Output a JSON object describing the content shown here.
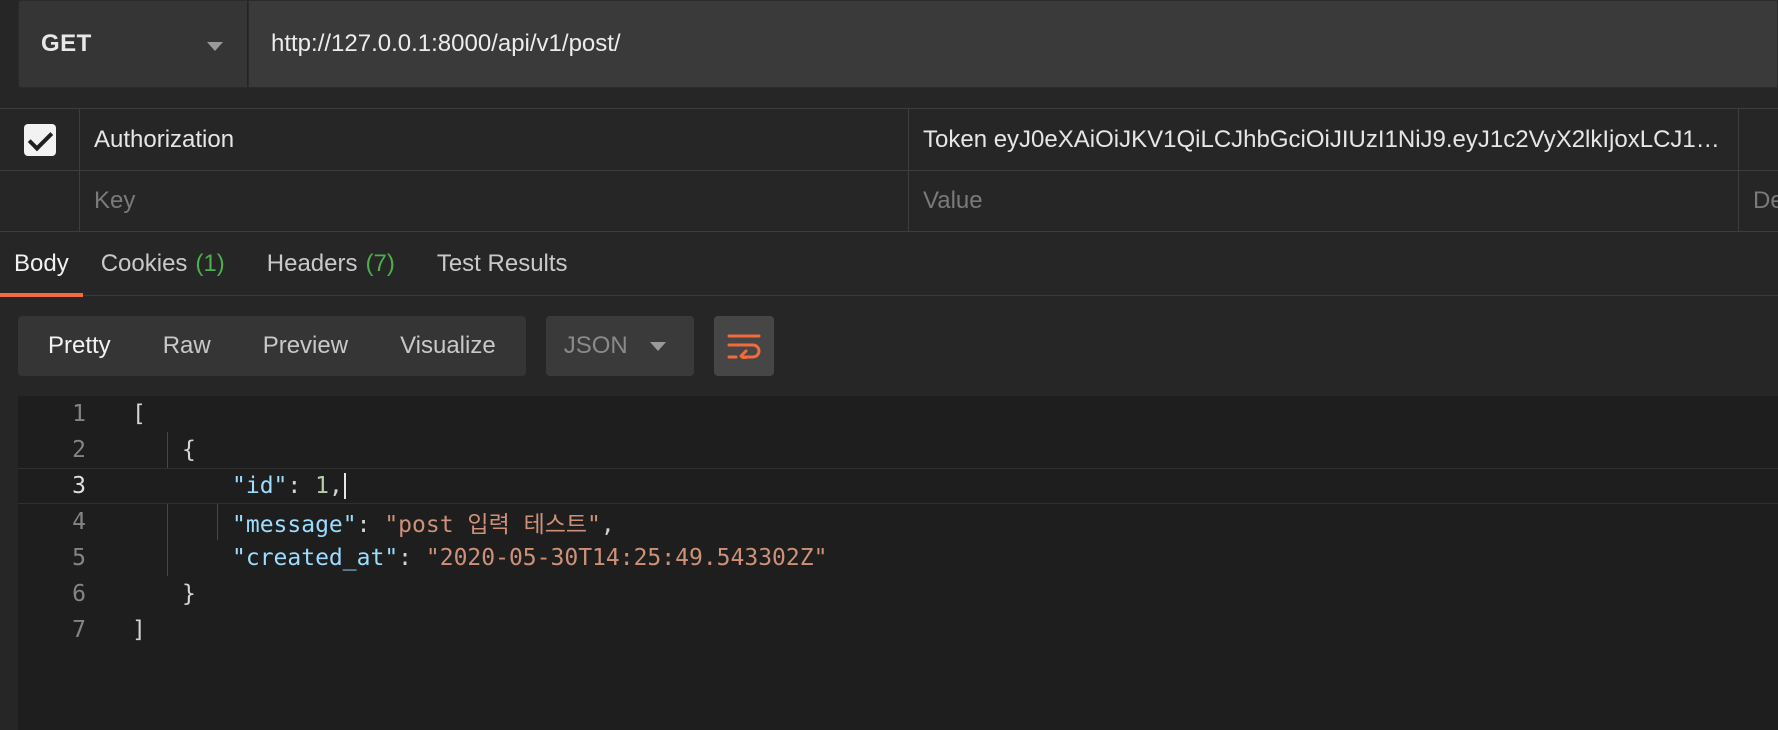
{
  "request": {
    "method": "GET",
    "url": "http://127.0.0.1:8000/api/v1/post/"
  },
  "headers_table": {
    "rows": [
      {
        "checked": true,
        "key": "Authorization",
        "value": "Token eyJ0eXAiOiJKV1QiLCJhbGciOiJIUzI1NiJ9.eyJ1c2VyX2lkIjoxLCJ1c2Vy…"
      }
    ],
    "new_row": {
      "key_placeholder": "Key",
      "value_placeholder": "Value",
      "description_placeholder": "De"
    }
  },
  "response_tabs": [
    {
      "label": "Body",
      "count": ""
    },
    {
      "label": "Cookies",
      "count": "(1)"
    },
    {
      "label": "Headers",
      "count": "(7)"
    },
    {
      "label": "Test Results",
      "count": ""
    }
  ],
  "view_modes": [
    "Pretty",
    "Raw",
    "Preview",
    "Visualize"
  ],
  "format": "JSON",
  "code_lines": {
    "numbers": [
      "1",
      "2",
      "3",
      "4",
      "5",
      "6",
      "7"
    ],
    "l1": "[",
    "l2": "{",
    "l3_key": "\"id\"",
    "l3_sep": ": ",
    "l3_val": "1",
    "l3_comma": ",",
    "l4_key": "\"message\"",
    "l4_sep": ": ",
    "l4_val": "\"post 입력 테스트\"",
    "l4_comma": ",",
    "l5_key": "\"created_at\"",
    "l5_sep": ": ",
    "l5_val": "\"2020-05-30T14:25:49.543302Z\"",
    "l6": "}",
    "l7": "]"
  },
  "colors": {
    "accent": "#f26b3a",
    "count_green": "#4cae4c",
    "json_key": "#9cdcfe",
    "json_string": "#ce9178",
    "json_number": "#b5cea8"
  }
}
